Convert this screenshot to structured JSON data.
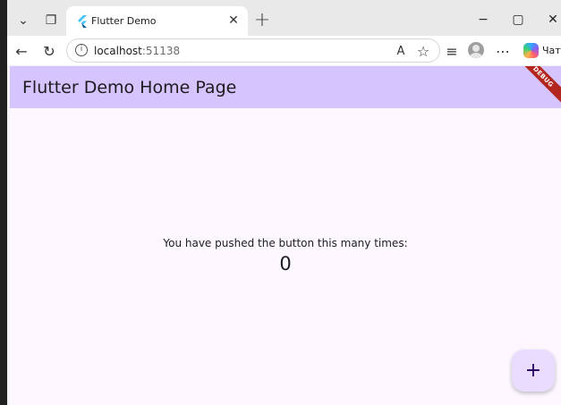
{
  "browser": {
    "tab": {
      "title": "Flutter Demo",
      "close_glyph": "✕"
    },
    "new_tab_glyph": "+",
    "tab_actions_glyph": "⌄",
    "tab_collections_glyph": "❐",
    "window_controls": {
      "minimize": "−",
      "maximize": "▢",
      "close": "✕"
    },
    "toolbar": {
      "back_glyph": "←",
      "refresh_glyph": "↻",
      "address_host": "localhost",
      "address_port": ":51138",
      "read_aloud_glyph": "A",
      "favorite_glyph": "☆",
      "favorites_list_glyph": "≡",
      "more_glyph": "⋯",
      "copilot_label": "Чат"
    },
    "icons": {
      "tab_actions": "chevron-down-icon",
      "workspaces": "tab-collections-icon",
      "favicon": "flutter-logo-icon",
      "back": "arrow-left-icon",
      "refresh": "refresh-icon",
      "site_info": "info-icon",
      "read_aloud": "read-aloud-icon",
      "favorite": "star-icon",
      "favorites": "favorites-list-icon",
      "profile": "avatar-icon",
      "more": "more-dots-icon",
      "copilot": "copilot-icon"
    }
  },
  "app": {
    "appbar_title": "Flutter Demo Home Page",
    "debug_banner": "DEBUG",
    "message": "You have pushed the button this many times:",
    "counter": "0",
    "fab_glyph": "+",
    "colors": {
      "appbar": "#d5c4fe",
      "background": "#fdf7ff",
      "fab": "#eadcff",
      "debug_banner": "#b3261e"
    }
  }
}
